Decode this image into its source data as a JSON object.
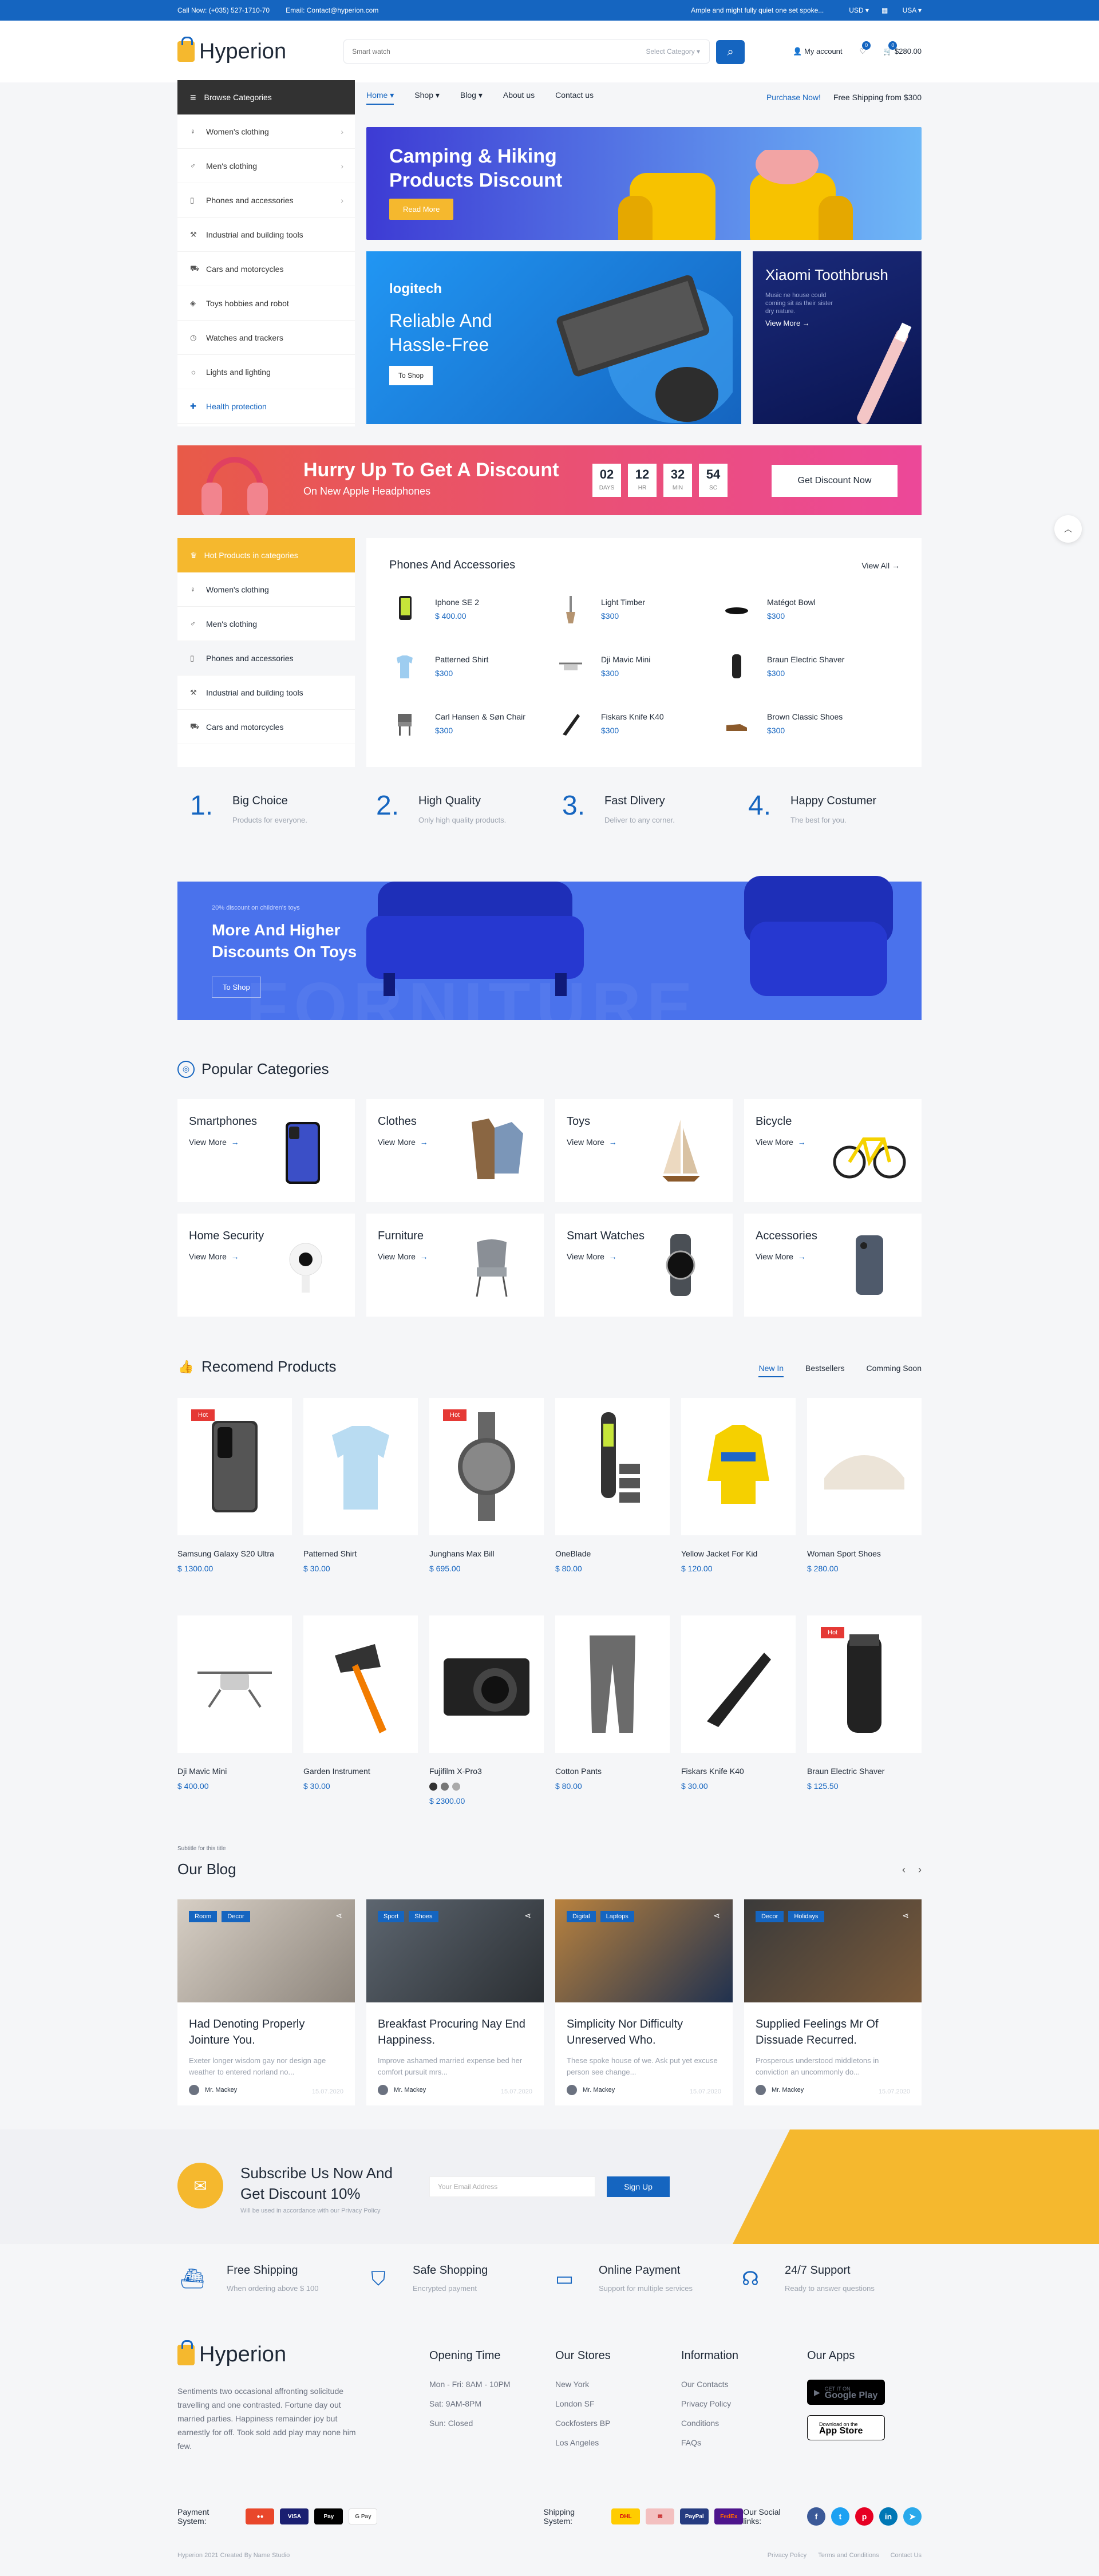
{
  "topbar": {
    "phone": "Call Now: (+035) 527-1710-70",
    "email": "Email: Contact@hyperion.com",
    "promo": "Ample and might fully quiet one set spoke...",
    "currency": "USD",
    "lang": "USA"
  },
  "header": {
    "logo": "Hyperion",
    "search_placeholder": "Smart watch",
    "category": "Select Category",
    "account": "My account",
    "wish_count": "0",
    "cart_count": "0",
    "cart_total": "$280.00"
  },
  "nav": {
    "browse": "Browse Categories",
    "menu": [
      "Home",
      "Shop",
      "Blog",
      "About us",
      "Contact us"
    ],
    "purchase": "Purchase Now!",
    "shipping": "Free Shipping from $300"
  },
  "sidebar": [
    "Women's clothing",
    "Men's clothing",
    "Phones and accessories",
    "Industrial and building tools",
    "Cars and motorcycles",
    "Toys hobbies and robot",
    "Watches and trackers",
    "Lights and lighting",
    "Health protection"
  ],
  "banner1": {
    "title": "Camping & Hiking Products Discount",
    "btn": "Read More"
  },
  "banner2": {
    "brand": "logitech",
    "title": "Reliable And Hassle-Free",
    "btn": "To Shop"
  },
  "banner3": {
    "title": "Xiaomi Toothbrush",
    "text": "Music ne house could coming sit as their sister dry nature.",
    "btn": "View More →"
  },
  "promo": {
    "title": "Hurry Up To Get A Discount",
    "sub": "On New Apple Headphones",
    "count": [
      {
        "v": "02",
        "l": "DAYS"
      },
      {
        "v": "12",
        "l": "HR"
      },
      {
        "v": "32",
        "l": "MIN"
      },
      {
        "v": "54",
        "l": "SC"
      }
    ],
    "btn": "Get Discount Now"
  },
  "hot": {
    "title": "Hot Products in categories",
    "items": [
      "Women's clothing",
      "Men's clothing",
      "Phones and accessories",
      "Industrial and building tools",
      "Cars and motorcycles"
    ]
  },
  "pa": {
    "title": "Phones And Accessories",
    "viewall": "View All →",
    "items": [
      {
        "n": "Iphone SE 2",
        "p": "$ 400.00"
      },
      {
        "n": "Light Timber",
        "p": "$300"
      },
      {
        "n": "Matégot Bowl",
        "p": "$300"
      },
      {
        "n": "Patterned Shirt",
        "p": "$300"
      },
      {
        "n": "Dji Mavic Mini",
        "p": "$300"
      },
      {
        "n": "Braun Electric Shaver",
        "p": "$300"
      },
      {
        "n": "Carl Hansen & Søn Chair",
        "p": "$300"
      },
      {
        "n": "Fiskars Knife K40",
        "p": "$300"
      },
      {
        "n": "Brown Classic Shoes",
        "p": "$300"
      }
    ]
  },
  "features": [
    {
      "n": "1.",
      "t": "Big Choice",
      "d": "Products for everyone."
    },
    {
      "n": "2.",
      "t": "High Quality",
      "d": "Only high quality products."
    },
    {
      "n": "3.",
      "t": "Fast Dlivery",
      "d": "Deliver to any corner."
    },
    {
      "n": "4.",
      "t": "Happy Costumer",
      "d": "The best for you."
    }
  ],
  "toys": {
    "small": "20% discount on children's toys",
    "title": "More And Higher Discounts On Toys",
    "btn": "To Shop",
    "bg": "FORNITURE"
  },
  "popular": {
    "title": "Popular Categories",
    "view": "View More",
    "items": [
      "Smartphones",
      "Clothes",
      "Toys",
      "Bicycle",
      "Home Security",
      "Furniture",
      "Smart Watches",
      "Accessories"
    ]
  },
  "recommend": {
    "title": "Recomend Products",
    "tabs": [
      "New In",
      "Bestsellers",
      "Comming Soon"
    ],
    "hot": "Hot",
    "products": [
      {
        "n": "Samsung Galaxy S20 Ultra",
        "p": "$ 1300.00"
      },
      {
        "n": "Patterned Shirt",
        "p": "$ 30.00"
      },
      {
        "n": "Junghans Max Bill",
        "p": "$ 695.00"
      },
      {
        "n": "OneBlade",
        "p": "$ 80.00"
      },
      {
        "n": "Yellow Jacket For Kid",
        "p": "$ 120.00"
      },
      {
        "n": "Woman Sport Shoes",
        "p": "$ 280.00"
      },
      {
        "n": "Dji Mavic Mini",
        "p": "$ 400.00"
      },
      {
        "n": "Garden Instrument",
        "p": "$ 30.00"
      },
      {
        "n": "Fujifilm X-Pro3",
        "p": "$ 2300.00"
      },
      {
        "n": "Cotton Pants",
        "p": "$ 80.00"
      },
      {
        "n": "Fiskars Knife K40",
        "p": "$ 30.00"
      },
      {
        "n": "Braun Electric Shaver",
        "p": "$ 125.50"
      }
    ]
  },
  "blog": {
    "subtitle": "Subtitle for this title",
    "title": "Our Blog",
    "posts": [
      {
        "t1": "Room",
        "t2": "Decor",
        "h": "Had Denoting Properly Jointure You.",
        "p": "Exeter longer wisdom gay nor design age weather to entered norland no...",
        "a": "Mr. Mackey",
        "d": "15.07.2020"
      },
      {
        "t1": "Sport",
        "t2": "Shoes",
        "h": "Breakfast Procuring Nay End Happiness.",
        "p": "Improve ashamed married expense bed her comfort pursuit mrs...",
        "a": "Mr. Mackey",
        "d": "15.07.2020"
      },
      {
        "t1": "Digital",
        "t2": "Laptops",
        "h": "Simplicity Nor Difficulty Unreserved Who.",
        "p": "These spoke house of we. Ask put yet excuse person see change...",
        "a": "Mr. Mackey",
        "d": "15.07.2020"
      },
      {
        "t1": "Decor",
        "t2": "Holidays",
        "h": "Supplied Feelings Mr Of Dissuade Recurred.",
        "p": "Prosperous understood middletons in conviction an uncommonly do...",
        "a": "Mr. Mackey",
        "d": "15.07.2020"
      }
    ]
  },
  "subscribe": {
    "title": "Subscribe Us Now And Get Discount 10%",
    "privacy": "Will be used in accordance with our Privacy Policy",
    "placeholder": "Your Email Address",
    "btn": "Sign Up"
  },
  "services": [
    {
      "t": "Free Shipping",
      "d": "When ordering above $ 100"
    },
    {
      "t": "Safe Shopping",
      "d": "Encrypted payment"
    },
    {
      "t": "Online Payment",
      "d": "Support for multiple services"
    },
    {
      "t": "24/7 Support",
      "d": "Ready to answer questions"
    }
  ],
  "footer": {
    "about": "Sentiments two occasional affronting solicitude travelling and one contrasted. Fortune day out married parties. Happiness remainder joy but earnestly for off. Took sold add play may none him few.",
    "hours": {
      "t": "Opening Time",
      "l": [
        "Mon - Fri: 8AM - 10PM",
        "Sat: 9AM-8PM",
        "Sun: Closed"
      ]
    },
    "stores": {
      "t": "Our Stores",
      "l": [
        "New York",
        "London SF",
        "Cockfosters BP",
        "Los Angeles"
      ]
    },
    "info": {
      "t": "Information",
      "l": [
        "Our Contacts",
        "Privacy Policy",
        "Conditions",
        "FAQs"
      ]
    },
    "apps": {
      "t": "Our Apps",
      "gp_small": "GET IT ON",
      "gp": "Google Play",
      "as_small": "Download on the",
      "as": "App Store"
    },
    "payment_label": "Payment System:",
    "shipping_label": "Shipping System:",
    "social_label": "Our Social links:",
    "copyright": "Hyperion 2021 Created By Name Studio",
    "links": [
      "Privacy Policy",
      "Terms and Conditions",
      "Contact Us"
    ]
  },
  "colors": {
    "primary": "#1565c0",
    "accent": "#f5b82e",
    "hot": "#e53935"
  }
}
